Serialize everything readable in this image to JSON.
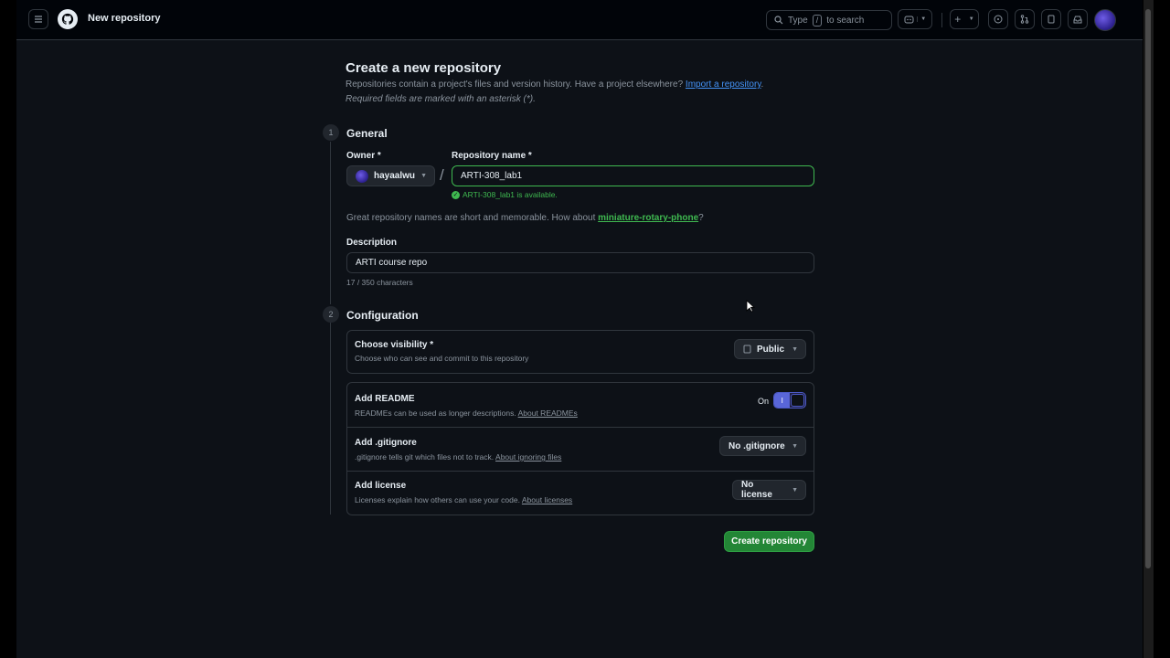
{
  "header": {
    "title": "New repository",
    "search_prefix": "Type",
    "search_key": "/",
    "search_suffix": "to search"
  },
  "page": {
    "title": "Create a new repository",
    "intro": "Repositories contain a project's files and version history. Have a project elsewhere?",
    "import_link": "Import a repository",
    "required_note": "Required fields are marked with an asterisk (*)."
  },
  "general": {
    "step": "1",
    "title": "General",
    "owner_label": "Owner *",
    "owner_value": "hayaalwu",
    "repo_label": "Repository name *",
    "repo_value": "ARTI-308_lab1",
    "availability": "ARTI-308_lab1 is available.",
    "suggest_text": "Great repository names are short and memorable. How about",
    "suggest_name": "miniature-rotary-phone",
    "suggest_end": "?",
    "description_label": "Description",
    "description_value": "ARTI course repo",
    "char_count": "17 / 350 characters"
  },
  "configuration": {
    "step": "2",
    "title": "Configuration",
    "visibility_title": "Choose visibility *",
    "visibility_sub": "Choose who can see and commit to this repository",
    "visibility_value": "Public",
    "readme_title": "Add README",
    "readme_sub": "READMEs can be used as longer descriptions.",
    "readme_link": "About READMEs",
    "readme_toggle_label": "On",
    "readme_toggle_on_glyph": "I",
    "gitignore_title": "Add .gitignore",
    "gitignore_sub": ".gitignore tells git which files not to track.",
    "gitignore_link": "About ignoring files",
    "gitignore_value": "No .gitignore",
    "license_title": "Add license",
    "license_sub": "Licenses explain how others can use your code.",
    "license_link": "About licenses",
    "license_value": "No license"
  },
  "actions": {
    "create": "Create repository"
  },
  "colors": {
    "accent_green": "#238636",
    "link_blue": "#4493f8",
    "success_green": "#3fb950",
    "toggle_on": "#5966d9"
  }
}
